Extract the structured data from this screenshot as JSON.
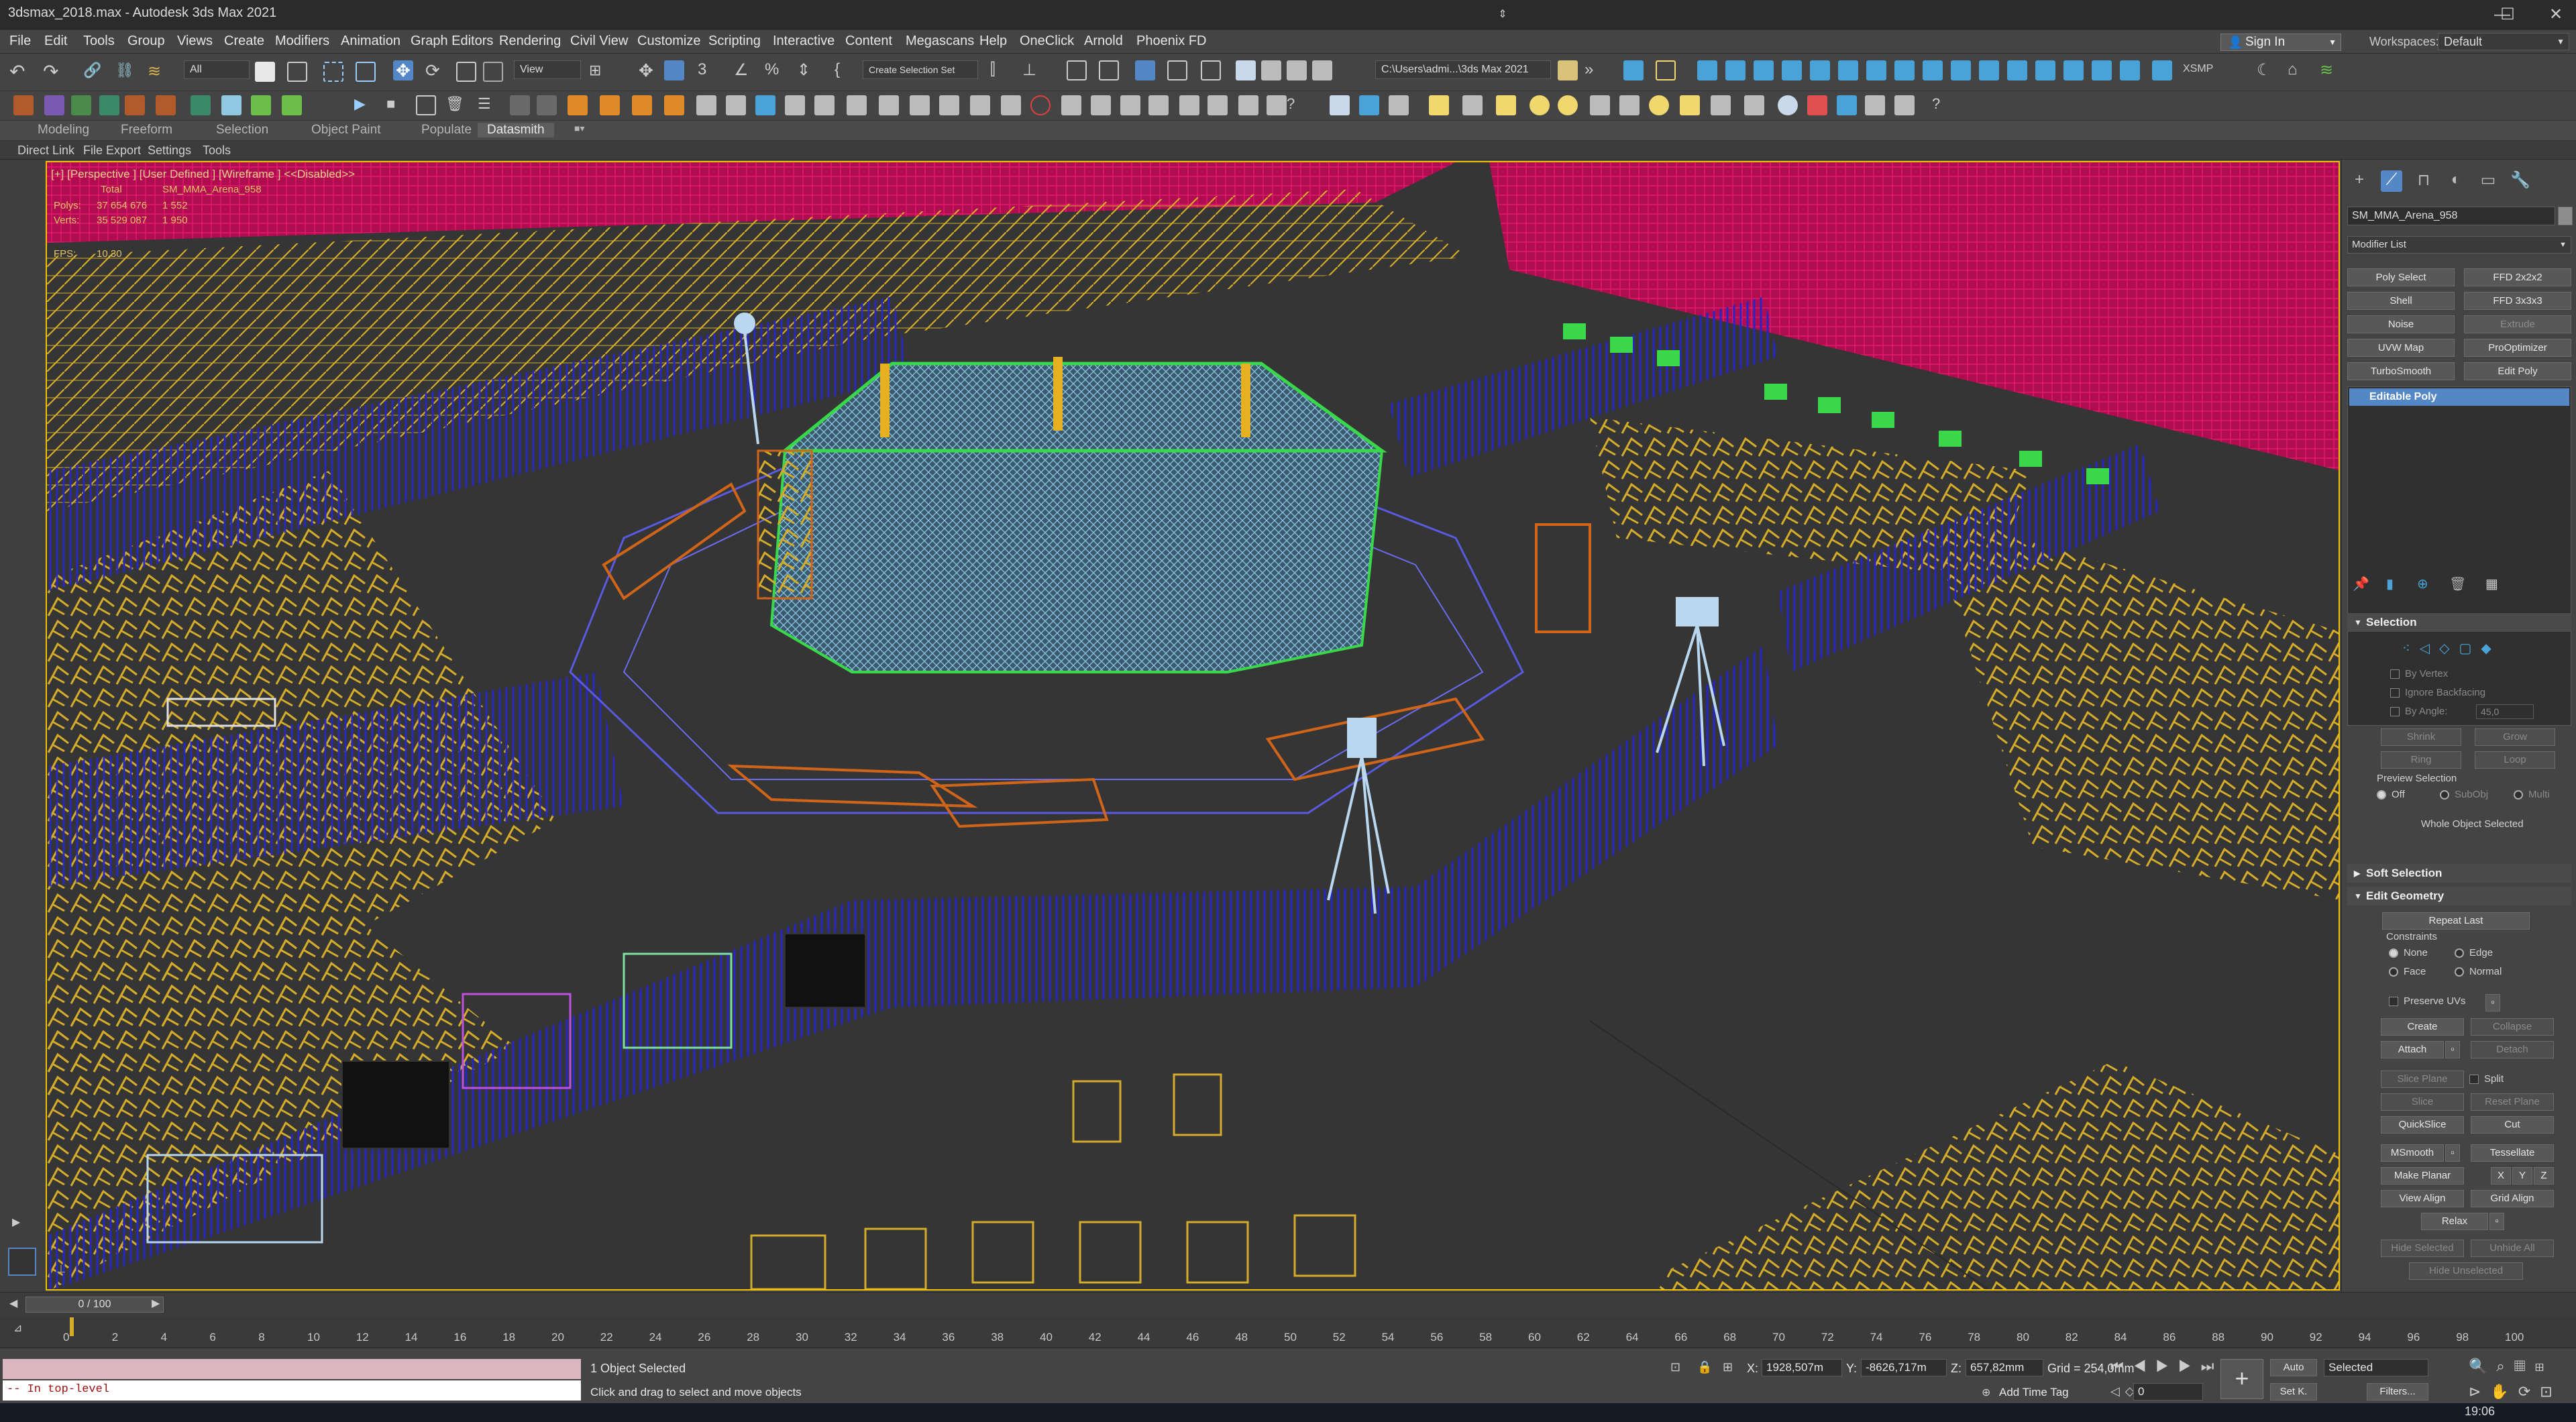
{
  "window": {
    "title": "3dsmax_2018.max - Autodesk 3ds Max 2021",
    "minimize": "—",
    "maximize": "☐",
    "close": "✕"
  },
  "menu": {
    "items": [
      "File",
      "Edit",
      "Tools",
      "Group",
      "Views",
      "Create",
      "Modifiers",
      "Animation",
      "Graph Editors",
      "Rendering",
      "Civil View",
      "Customize",
      "Scripting",
      "Interactive",
      "Content",
      "Megascans",
      "Help",
      "OneClick",
      "Arnold",
      "Phoenix FD"
    ],
    "sign_in": "Sign In",
    "workspaces_label": "Workspaces:",
    "workspace_value": "Default"
  },
  "toolbar": {
    "selection_filter": "All",
    "ref_coord": "View",
    "named_selection": "Create Selection Set",
    "project_path": "C:\\Users\\admi...\\3ds Max 2021",
    "xsmp": "XSMP"
  },
  "ribbon": {
    "tabs": [
      "Modeling",
      "Freeform",
      "Selection",
      "Object Paint",
      "Populate",
      "Datasmith"
    ],
    "active_tab": "Datasmith",
    "sub_items": [
      "Direct Link",
      "File Export",
      "Settings",
      "Tools"
    ]
  },
  "viewport": {
    "label": "[+] [Perspective ] [User Defined ] [Wireframe ] <<Disabled>>",
    "stats": {
      "total_label": "Total",
      "object_label": "SM_MMA_Arena_958",
      "polys_label": "Polys:",
      "polys_total": "37 654 676",
      "polys_obj": "1 552",
      "verts_label": "Verts:",
      "verts_total": "35 529 087",
      "verts_obj": "1 950",
      "fps_label": "FPS:",
      "fps_value": "10,30"
    }
  },
  "command_panel": {
    "object_name": "SM_MMA_Arena_958",
    "modifier_list": "Modifier List",
    "modifier_buttons": [
      {
        "label": "Poly Select",
        "dim": false
      },
      {
        "label": "FFD 2x2x2",
        "dim": false
      },
      {
        "label": "Shell",
        "dim": false
      },
      {
        "label": "FFD 3x3x3",
        "dim": false
      },
      {
        "label": "Noise",
        "dim": false
      },
      {
        "label": "Extrude",
        "dim": true
      },
      {
        "label": "UVW Map",
        "dim": false
      },
      {
        "label": "ProOptimizer",
        "dim": false
      },
      {
        "label": "TurboSmooth",
        "dim": false
      },
      {
        "label": "Edit Poly",
        "dim": false
      }
    ],
    "stack_item": "Editable Poly",
    "selection": {
      "header": "Selection",
      "by_vertex": "By Vertex",
      "ignore_backfacing": "Ignore Backfacing",
      "by_angle": "By Angle:",
      "angle_value": "45,0",
      "shrink": "Shrink",
      "grow": "Grow",
      "ring": "Ring",
      "loop": "Loop",
      "preview_selection": "Preview Selection",
      "off": "Off",
      "subobj": "SubObj",
      "multi": "Multi",
      "whole_object": "Whole Object Selected"
    },
    "soft_selection": "Soft Selection",
    "edit_geometry": {
      "header": "Edit Geometry",
      "repeat_last": "Repeat Last",
      "constraints": "Constraints",
      "none": "None",
      "edge": "Edge",
      "face": "Face",
      "normal": "Normal",
      "preserve_uvs": "Preserve UVs",
      "create": "Create",
      "collapse": "Collapse",
      "attach": "Attach",
      "detach": "Detach",
      "slice_plane": "Slice Plane",
      "split": "Split",
      "slice": "Slice",
      "reset_plane": "Reset Plane",
      "quickslice": "QuickSlice",
      "cut": "Cut",
      "msmooth": "MSmooth",
      "tessellate": "Tessellate",
      "make_planar": "Make Planar",
      "x": "X",
      "y": "Y",
      "z": "Z",
      "view_align": "View Align",
      "grid_align": "Grid Align",
      "relax": "Relax",
      "hide_selected": "Hide Selected",
      "unhide_all": "Unhide All",
      "hide_unselected": "Hide Unselected"
    }
  },
  "timeline": {
    "slider": "0 / 100",
    "ticks": [
      "0",
      "2",
      "4",
      "6",
      "8",
      "10",
      "12",
      "14",
      "16",
      "18",
      "20",
      "22",
      "24",
      "26",
      "28",
      "30",
      "32",
      "34",
      "36",
      "38",
      "40",
      "42",
      "44",
      "46",
      "48",
      "50",
      "52",
      "54",
      "56",
      "58",
      "60",
      "62",
      "64",
      "66",
      "68",
      "70",
      "72",
      "74",
      "76",
      "78",
      "80",
      "82",
      "84",
      "86",
      "88",
      "90",
      "92",
      "94",
      "96",
      "98",
      "100"
    ]
  },
  "status": {
    "maxscript_output": "",
    "maxscript_input": "-- In top-level",
    "selected_count": "1 Object Selected",
    "prompt": "Click and drag to select and move objects",
    "x_label": "X:",
    "x_value": "1928,507m",
    "y_label": "Y:",
    "y_value": "-8626,717m",
    "z_label": "Z:",
    "z_value": "657,82mm",
    "grid": "Grid = 254,0mm",
    "add_time_tag": "Add Time Tag",
    "auto": "Auto",
    "set_key": "Set K.",
    "key_mode": "Selected",
    "filters": "Filters...",
    "frame": "0",
    "clock": "19:06"
  },
  "colors": {
    "accent": "#5487c5",
    "chairs": "#d4ac2a",
    "barriers": "#1c1ca8",
    "seats": "#c0105a",
    "cage": "#7ec6e6",
    "tables": "#d0651a"
  }
}
